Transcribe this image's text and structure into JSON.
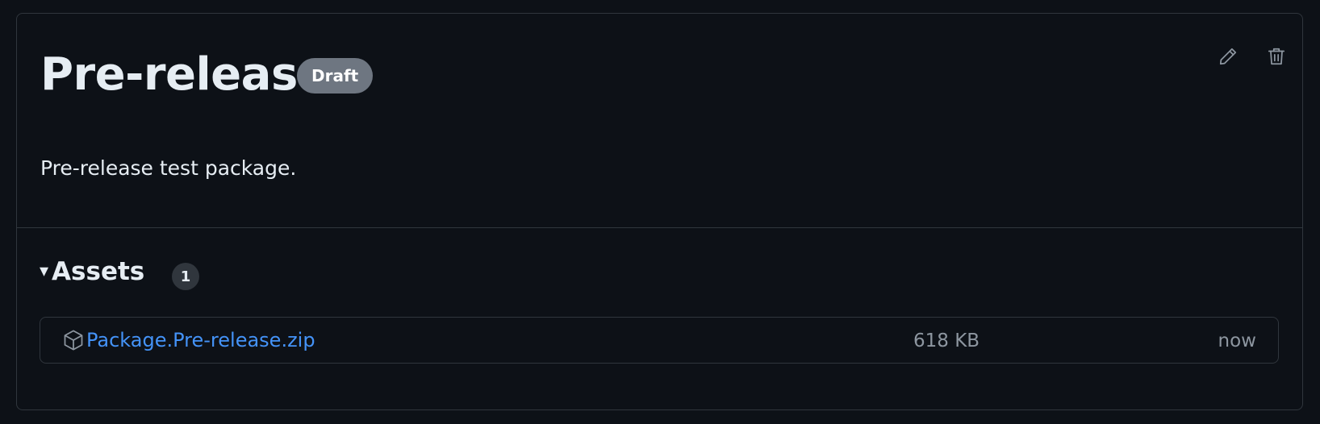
{
  "release": {
    "title": "Pre-release",
    "badge": "Draft",
    "description": "Pre-release test package."
  },
  "actions": {
    "edit_icon": "pencil-icon",
    "delete_icon": "trash-icon"
  },
  "assets": {
    "heading": "Assets",
    "count": "1",
    "caret": "▾",
    "items": [
      {
        "name": "Package.Pre-release.zip",
        "size": "618 KB",
        "time": "now",
        "icon": "package-icon"
      }
    ]
  },
  "colors": {
    "background": "#0d1117",
    "border": "#30363d",
    "link": "#4493f8",
    "muted": "#8d96a0",
    "badge": "#6e7681"
  }
}
